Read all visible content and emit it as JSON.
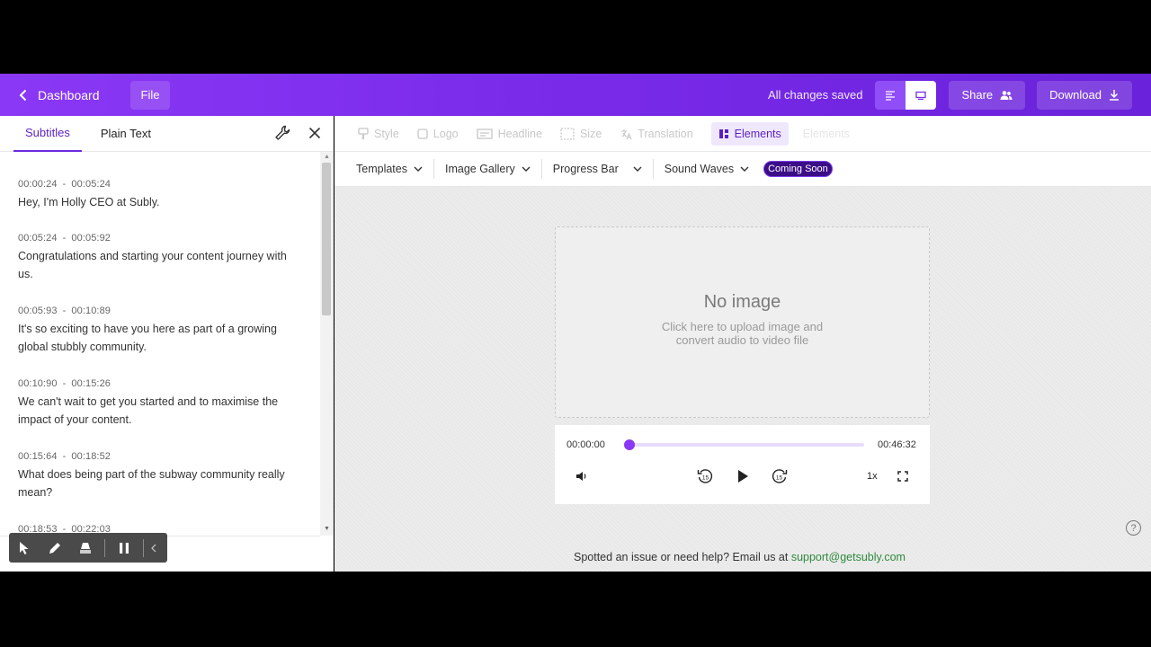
{
  "topbar": {
    "back_label": "Dashboard",
    "file_label": "File",
    "saved_status": "All changes saved",
    "share_label": "Share",
    "download_label": "Download",
    "accent_color": "#7a2bea"
  },
  "left_panel": {
    "tabs": [
      {
        "label": "Subtitles",
        "active": true
      },
      {
        "label": "Plain Text",
        "active": false
      }
    ],
    "subtitles": [
      {
        "start": "00:00:24",
        "end": "00:05:24",
        "text": "Hey, I'm Holly CEO at Subly."
      },
      {
        "start": "00:05:24",
        "end": "00:05:92",
        "text": "Congratulations and starting your content journey with us."
      },
      {
        "start": "00:05:93",
        "end": "00:10:89",
        "text": "It's so exciting to have you here as part of a growing global stubbly community."
      },
      {
        "start": "00:10:90",
        "end": "00:15:26",
        "text": "We can't wait to get you started and to maximise the impact of your content."
      },
      {
        "start": "00:15:64",
        "end": "00:18:52",
        "text": "What does being part of the subway community really mean?"
      },
      {
        "start": "00:18:53",
        "end": "00:22:03",
        "text": ""
      }
    ],
    "time_separator": "-"
  },
  "right_panel": {
    "tabs": [
      {
        "label": "Style",
        "icon": "style-icon"
      },
      {
        "label": "Logo",
        "icon": "logo-icon"
      },
      {
        "label": "Headline",
        "icon": "headline-icon"
      },
      {
        "label": "Size",
        "icon": "size-icon"
      },
      {
        "label": "Translation",
        "icon": "translation-icon"
      },
      {
        "label": "Elements",
        "icon": "elements-icon",
        "active": true
      },
      {
        "label": "Elements",
        "icon": "elements-icon"
      }
    ],
    "subtabs": [
      {
        "label": "Templates"
      },
      {
        "label": "Image Gallery"
      },
      {
        "label": "Progress Bar"
      },
      {
        "label": "Sound Waves"
      }
    ],
    "coming_soon": "Coming Soon",
    "image_placeholder": {
      "title": "No image",
      "hint": "Click here to upload image and convert audio to video file"
    },
    "player": {
      "current_time": "00:00:00",
      "duration": "00:46:32",
      "progress": 0,
      "speed": "1x",
      "skip_seconds": "15"
    },
    "help_icon": "?",
    "footer": {
      "text": "Spotted an issue or need help? Email us at ",
      "email": "support@getsubly.com"
    }
  }
}
